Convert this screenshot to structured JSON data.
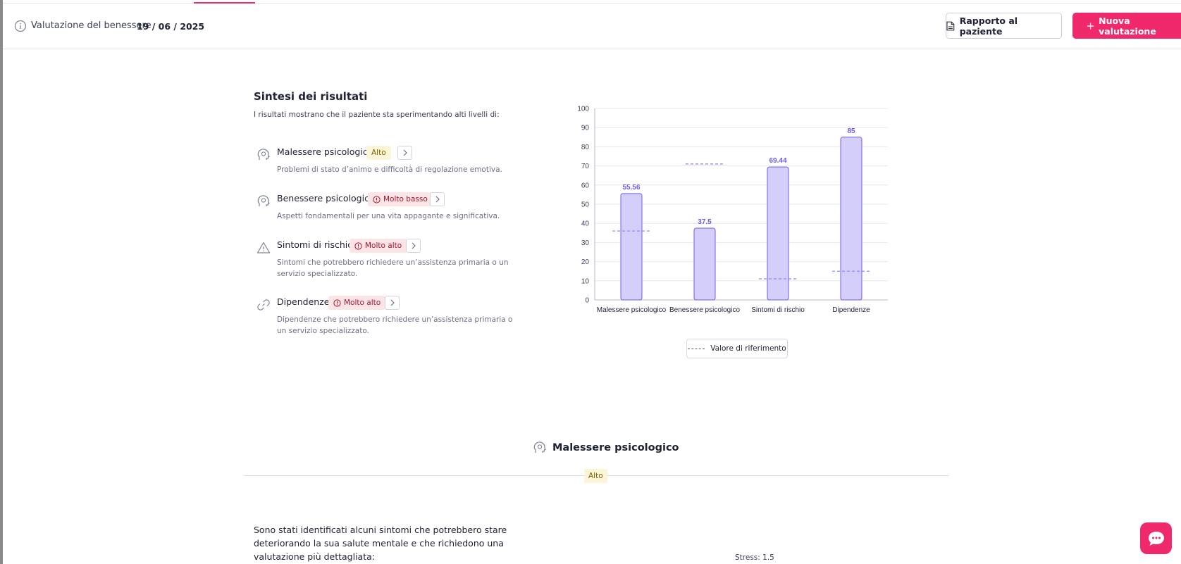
{
  "header": {
    "label": "Valutazione del benessere",
    "date": "19 / 06 / 2025",
    "report_button": "Rapporto al paziente",
    "new_button": "Nuova valutazione",
    "icons": {
      "info": "info-icon",
      "report": "document-icon",
      "new": "plus-icon"
    }
  },
  "summary": {
    "title": "Sintesi dei risultati",
    "intro": "I risultati mostrano che il paziente sta sperimentando alti livelli di:",
    "items": [
      {
        "name": "Malessere psicologico",
        "badge": "Alto",
        "level": "high",
        "icon": "head-icon",
        "description": "Problemi di stato d’animo e difficoltà di regolazione emotiva."
      },
      {
        "name": "Benessere psicologico",
        "badge": "Molto basso",
        "level": "critical",
        "icon": "head-icon",
        "description": "Aspetti fondamentali per una vita appagante e significativa."
      },
      {
        "name": "Sintomi di rischio",
        "badge": "Molto alto",
        "level": "critical",
        "icon": "warning-icon",
        "description": "Sintomi che potrebbero richiedere un’assistenza primaria o un servizio specializzato."
      },
      {
        "name": "Dipendenze",
        "badge": "Molto alto",
        "level": "critical",
        "icon": "link-icon",
        "description": "Dipendenze che potrebbero richiedere un’assistenza primaria o un servizio specializzato."
      }
    ]
  },
  "chart_data": {
    "type": "bar",
    "categories": [
      "Malessere psicologico",
      "Benessere psicologico",
      "Sintomi di rischio",
      "Dipendenze"
    ],
    "values": [
      55.56,
      37.5,
      69.44,
      85
    ],
    "data_labels": [
      "55.56",
      "37.5",
      "69.44",
      "85"
    ],
    "reference_values": [
      36,
      71,
      11,
      15
    ],
    "ylim": [
      0,
      100
    ],
    "yticks": [
      0,
      10,
      20,
      30,
      40,
      50,
      60,
      70,
      80,
      90,
      100
    ],
    "grid": true,
    "legend_position": "bottom",
    "legend": [
      "Valore di riferimento"
    ],
    "colors": {
      "bar_fill": "#d3cffa",
      "bar_stroke": "#6c5fe0",
      "label": "#6c5fe0",
      "reference": "#8a7ff0"
    }
  },
  "section": {
    "title": "Malessere psicologico",
    "badge": "Alto",
    "body": "Sono stati identificati alcuni sintomi che potrebbero stare deteriorando la sua salute mentale e che richiedono una valutazione più dettagliata:",
    "stress_label": "Stress: 1.5"
  },
  "colors": {
    "accent": "#f0296c",
    "high_bg": "#fdf5d8",
    "high_text": "#7a5b00",
    "critical_bg": "#fde4e7",
    "critical_text": "#a3162c"
  },
  "chat": {
    "icon": "chat-bubble-icon"
  }
}
